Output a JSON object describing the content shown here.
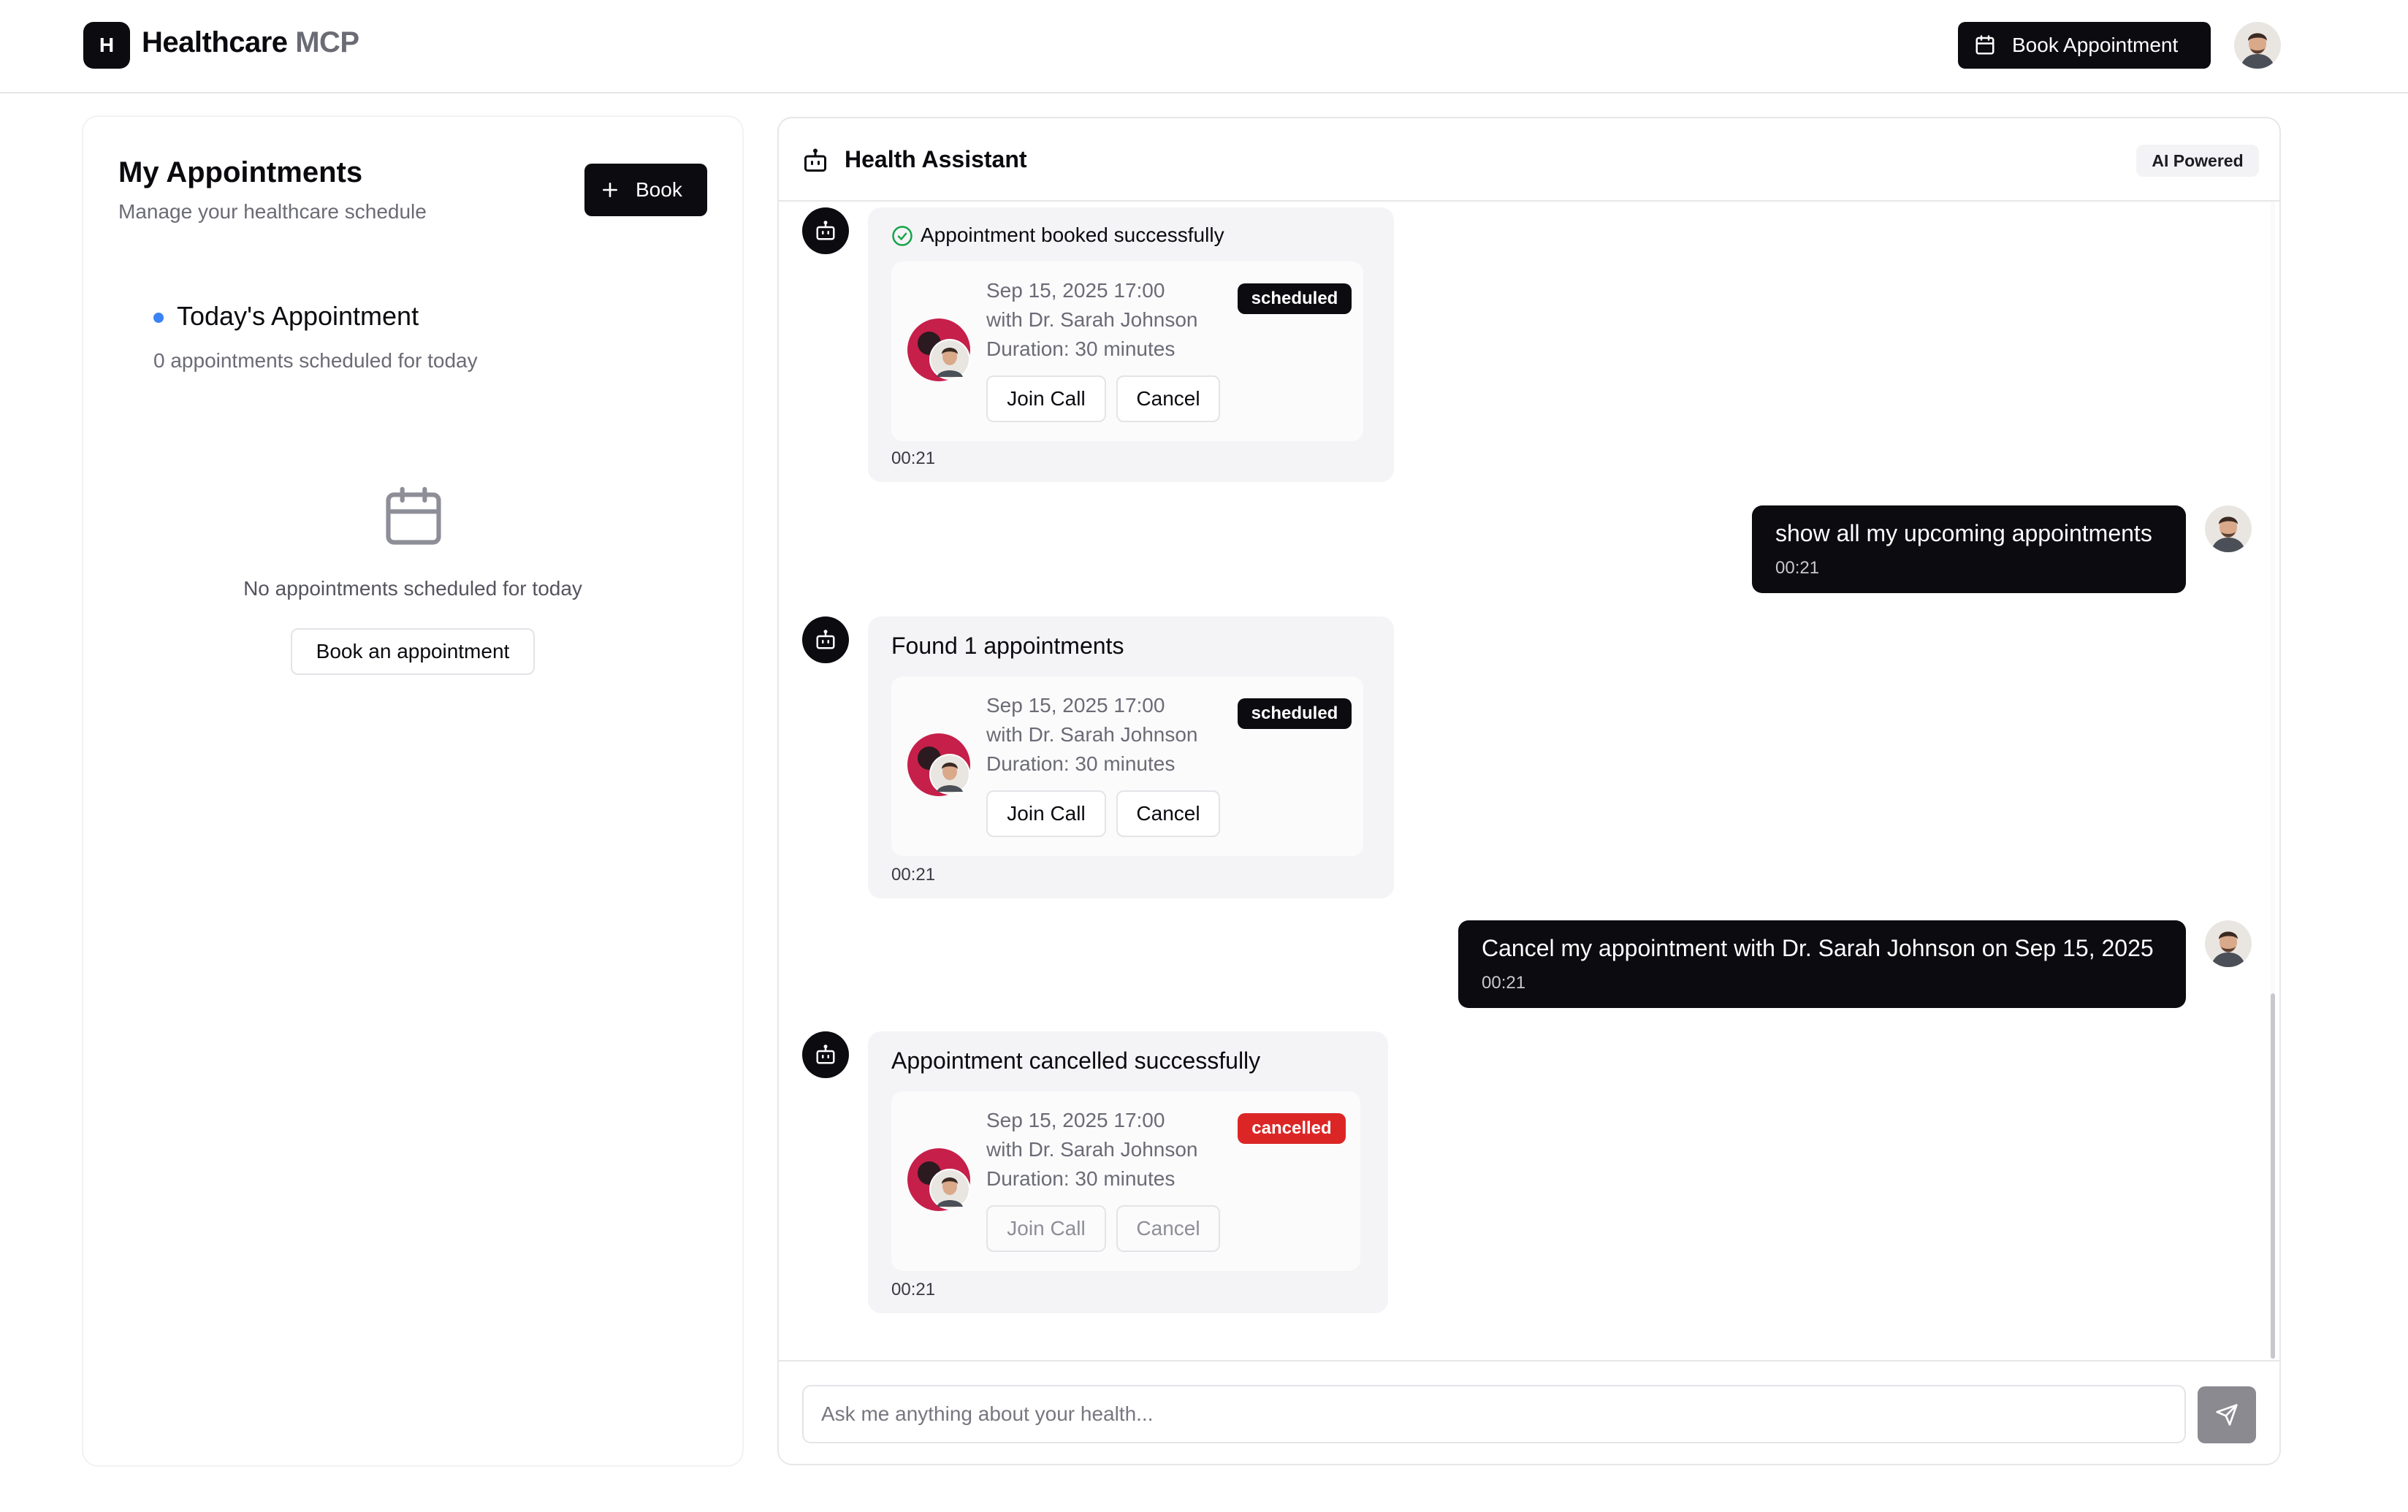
{
  "header": {
    "logo_letter": "H",
    "brand_main": "Healthcare",
    "brand_accent": "MCP",
    "book_button": "Book Appointment"
  },
  "left": {
    "title": "My Appointments",
    "subtitle": "Manage your healthcare schedule",
    "book_button": "Book",
    "today_title": "Today's Appointment",
    "today_count": "0 appointments scheduled for today",
    "empty_text": "No appointments scheduled for today",
    "empty_button": "Book an appointment"
  },
  "chat": {
    "title": "Health Assistant",
    "badge": "AI Powered",
    "input_placeholder": "Ask me anything about your health...",
    "messages": [
      {
        "role": "bot",
        "title": "Appointment booked successfully",
        "card": {
          "datetime": "Sep 15, 2025 17:00",
          "doctor": "with Dr. Sarah Johnson",
          "duration": "Duration: 30 minutes",
          "status": "scheduled",
          "join_label": "Join Call",
          "cancel_label": "Cancel"
        },
        "time": "00:21"
      },
      {
        "role": "user",
        "text": "show all my upcoming appointments",
        "time": "00:21"
      },
      {
        "role": "bot",
        "title": "Found 1 appointments",
        "card": {
          "datetime": "Sep 15, 2025 17:00",
          "doctor": "with Dr. Sarah Johnson",
          "duration": "Duration: 30 minutes",
          "status": "scheduled",
          "join_label": "Join Call",
          "cancel_label": "Cancel"
        },
        "time": "00:21"
      },
      {
        "role": "user",
        "text": "Cancel my appointment with Dr. Sarah Johnson on Sep 15, 2025",
        "time": "00:21"
      },
      {
        "role": "bot",
        "title": "Appointment cancelled successfully",
        "card": {
          "datetime": "Sep 15, 2025 17:00",
          "doctor": "with Dr. Sarah Johnson",
          "duration": "Duration: 30 minutes",
          "status": "cancelled",
          "join_label": "Join Call",
          "cancel_label": "Cancel"
        },
        "time": "00:21"
      }
    ]
  },
  "colors": {
    "primary": "#0b0b10",
    "accent_dot": "#3b82f6",
    "cancelled": "#dc2626",
    "success": "#16a34a"
  }
}
